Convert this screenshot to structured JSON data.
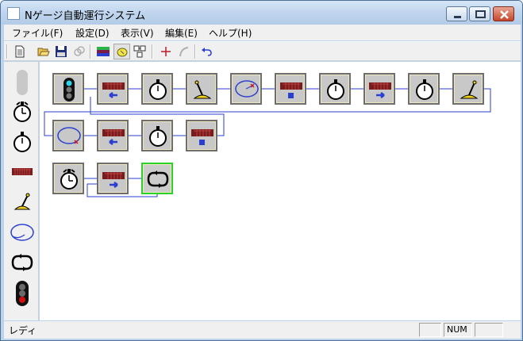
{
  "window": {
    "title": "Nゲージ自動運行システム"
  },
  "menu": [
    {
      "label": "ファイル(F)"
    },
    {
      "label": "設定(D)"
    },
    {
      "label": "表示(V)"
    },
    {
      "label": "編集(E)"
    },
    {
      "label": "ヘルプ(H)"
    }
  ],
  "toolbar": [
    {
      "icon": "new-file-icon"
    },
    {
      "icon": "open-folder-icon"
    },
    {
      "icon": "save-disk-icon"
    },
    {
      "icon": "link-icon",
      "disabled": true
    },
    {
      "icon": "color-bars-icon"
    },
    {
      "icon": "loop-ellipse-icon",
      "pressed": true
    },
    {
      "icon": "block-layout-icon"
    },
    {
      "icon": "plus-cross-icon"
    },
    {
      "icon": "curve-icon",
      "disabled": true
    },
    {
      "icon": "undo-icon"
    }
  ],
  "palette": [
    {
      "icon": "slider-handle-icon"
    },
    {
      "icon": "alarm-timer-icon"
    },
    {
      "icon": "stopwatch-icon"
    },
    {
      "icon": "train-car-icon"
    },
    {
      "icon": "track-switch-lever-icon"
    },
    {
      "icon": "track-loop-icon"
    },
    {
      "icon": "repeat-loop-icon"
    },
    {
      "icon": "traffic-signal-icon"
    }
  ],
  "blocks": {
    "row1": [
      "signal",
      "train-left",
      "stopwatch",
      "lever",
      "loop",
      "train-stop",
      "stopwatch",
      "train-right",
      "stopwatch",
      "lever"
    ],
    "row2": [
      "loop",
      "train-left",
      "stopwatch",
      "train-stop"
    ],
    "row3": [
      "alarm-timer",
      "train-right",
      "repeat-selected"
    ]
  },
  "status": {
    "text": "レディ",
    "num": "NUM"
  },
  "colors": {
    "accent": "#2b3fcf",
    "block_bg": "#f2e8bf",
    "selected_border": "#29d129",
    "train": "#7a1c1c"
  }
}
